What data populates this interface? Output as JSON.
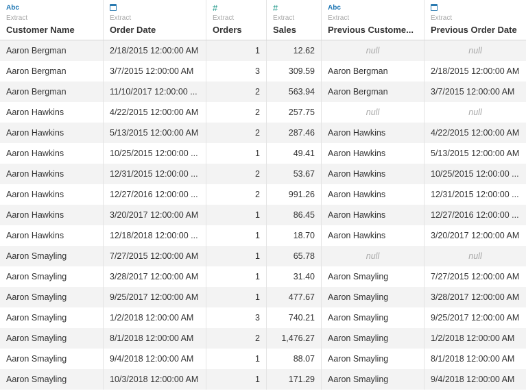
{
  "columns": [
    {
      "type_label": "Abc",
      "origin": "Extract",
      "name": "Customer Name"
    },
    {
      "type_label": "",
      "origin": "Extract",
      "name": "Order Date"
    },
    {
      "type_label": "#",
      "origin": "Extract",
      "name": "Orders"
    },
    {
      "type_label": "#",
      "origin": "Extract",
      "name": "Sales"
    },
    {
      "type_label": "Abc",
      "origin": "Extract",
      "name": "Previous Custome..."
    },
    {
      "type_label": "",
      "origin": "Extract",
      "name": "Previous Order Date"
    }
  ],
  "rows": [
    {
      "customer": "Aaron Bergman",
      "order_date": "2/18/2015 12:00:00 AM",
      "orders": "1",
      "sales": "12.62",
      "prev_customer": "null",
      "prev_order_date": "null"
    },
    {
      "customer": "Aaron Bergman",
      "order_date": "3/7/2015 12:00:00 AM",
      "orders": "3",
      "sales": "309.59",
      "prev_customer": "Aaron Bergman",
      "prev_order_date": "2/18/2015 12:00:00 AM"
    },
    {
      "customer": "Aaron Bergman",
      "order_date": "11/10/2017 12:00:00 ...",
      "orders": "2",
      "sales": "563.94",
      "prev_customer": "Aaron Bergman",
      "prev_order_date": "3/7/2015 12:00:00 AM"
    },
    {
      "customer": "Aaron Hawkins",
      "order_date": "4/22/2015 12:00:00 AM",
      "orders": "2",
      "sales": "257.75",
      "prev_customer": "null",
      "prev_order_date": "null"
    },
    {
      "customer": "Aaron Hawkins",
      "order_date": "5/13/2015 12:00:00 AM",
      "orders": "2",
      "sales": "287.46",
      "prev_customer": "Aaron Hawkins",
      "prev_order_date": "4/22/2015 12:00:00 AM"
    },
    {
      "customer": "Aaron Hawkins",
      "order_date": "10/25/2015 12:00:00 ...",
      "orders": "1",
      "sales": "49.41",
      "prev_customer": "Aaron Hawkins",
      "prev_order_date": "5/13/2015 12:00:00 AM"
    },
    {
      "customer": "Aaron Hawkins",
      "order_date": "12/31/2015 12:00:00 ...",
      "orders": "2",
      "sales": "53.67",
      "prev_customer": "Aaron Hawkins",
      "prev_order_date": "10/25/2015 12:00:00 ..."
    },
    {
      "customer": "Aaron Hawkins",
      "order_date": "12/27/2016 12:00:00 ...",
      "orders": "2",
      "sales": "991.26",
      "prev_customer": "Aaron Hawkins",
      "prev_order_date": "12/31/2015 12:00:00 ..."
    },
    {
      "customer": "Aaron Hawkins",
      "order_date": "3/20/2017 12:00:00 AM",
      "orders": "1",
      "sales": "86.45",
      "prev_customer": "Aaron Hawkins",
      "prev_order_date": "12/27/2016 12:00:00 ..."
    },
    {
      "customer": "Aaron Hawkins",
      "order_date": "12/18/2018 12:00:00 ...",
      "orders": "1",
      "sales": "18.70",
      "prev_customer": "Aaron Hawkins",
      "prev_order_date": "3/20/2017 12:00:00 AM"
    },
    {
      "customer": "Aaron Smayling",
      "order_date": "7/27/2015 12:00:00 AM",
      "orders": "1",
      "sales": "65.78",
      "prev_customer": "null",
      "prev_order_date": "null"
    },
    {
      "customer": "Aaron Smayling",
      "order_date": "3/28/2017 12:00:00 AM",
      "orders": "1",
      "sales": "31.40",
      "prev_customer": "Aaron Smayling",
      "prev_order_date": "7/27/2015 12:00:00 AM"
    },
    {
      "customer": "Aaron Smayling",
      "order_date": "9/25/2017 12:00:00 AM",
      "orders": "1",
      "sales": "477.67",
      "prev_customer": "Aaron Smayling",
      "prev_order_date": "3/28/2017 12:00:00 AM"
    },
    {
      "customer": "Aaron Smayling",
      "order_date": "1/2/2018 12:00:00 AM",
      "orders": "3",
      "sales": "740.21",
      "prev_customer": "Aaron Smayling",
      "prev_order_date": "9/25/2017 12:00:00 AM"
    },
    {
      "customer": "Aaron Smayling",
      "order_date": "8/1/2018 12:00:00 AM",
      "orders": "2",
      "sales": "1,476.27",
      "prev_customer": "Aaron Smayling",
      "prev_order_date": "1/2/2018 12:00:00 AM"
    },
    {
      "customer": "Aaron Smayling",
      "order_date": "9/4/2018 12:00:00 AM",
      "orders": "1",
      "sales": "88.07",
      "prev_customer": "Aaron Smayling",
      "prev_order_date": "8/1/2018 12:00:00 AM"
    },
    {
      "customer": "Aaron Smayling",
      "order_date": "10/3/2018 12:00:00 AM",
      "orders": "1",
      "sales": "171.29",
      "prev_customer": "Aaron Smayling",
      "prev_order_date": "9/4/2018 12:00:00 AM"
    }
  ],
  "colors": {
    "row_alt": "#f3f3f3",
    "null_text": "#a8a8a8",
    "string_type": "#1f77b4",
    "number_type": "#2a9d8f",
    "date_type": "#2a7ab0"
  },
  "icons": {
    "string": "abc-type-icon",
    "date": "calendar-type-icon",
    "number": "number-type-icon"
  }
}
